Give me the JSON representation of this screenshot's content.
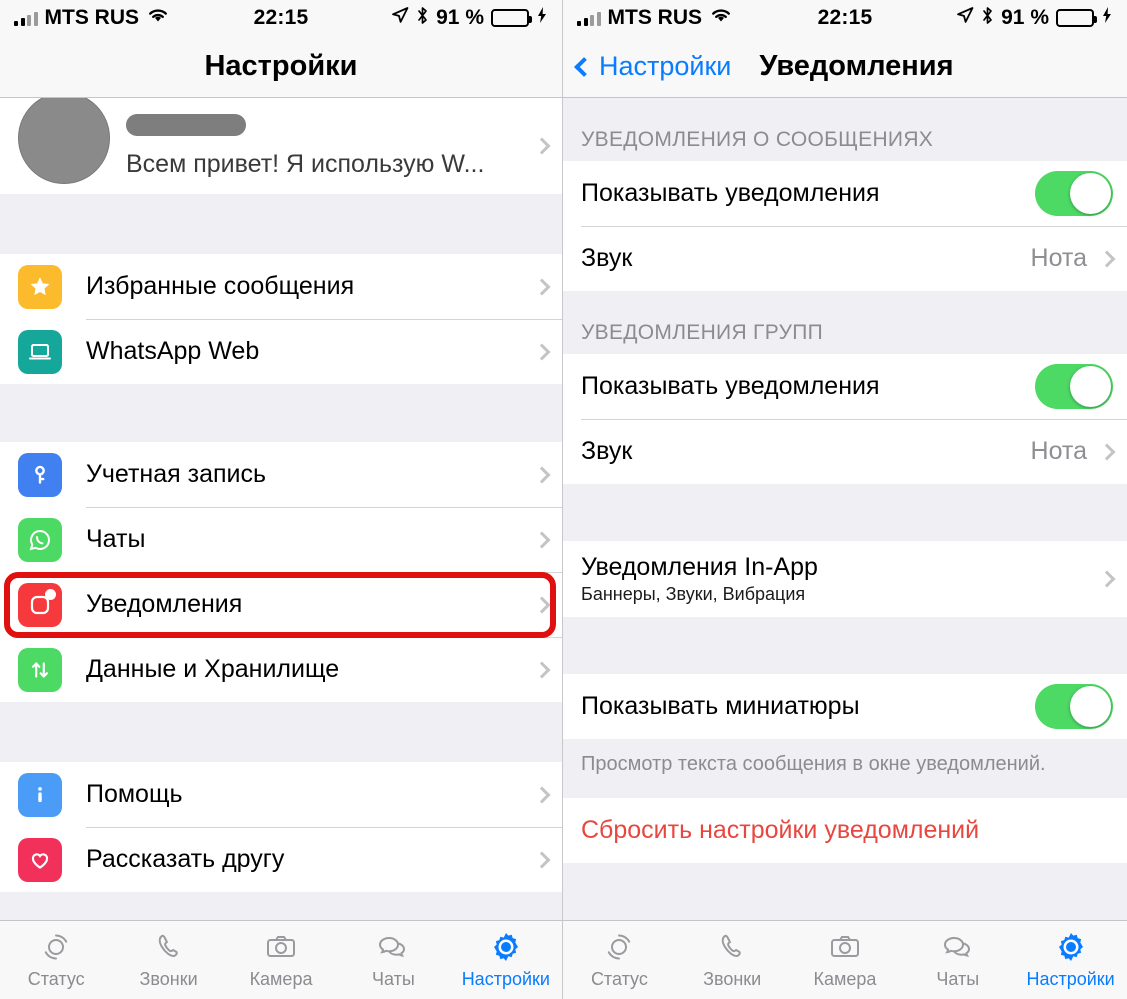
{
  "statusbar": {
    "carrier": "MTS RUS",
    "time": "22:15",
    "battery_percent": "91 %",
    "icons": [
      "signal-bars-icon",
      "wifi-icon",
      "location-arrow-icon",
      "bluetooth-icon",
      "battery-icon",
      "charging-bolt-icon"
    ]
  },
  "left_screen": {
    "nav": {
      "title": "Настройки"
    },
    "profile": {
      "name_redacted": true,
      "status": "Всем привет! Я использую W..."
    },
    "groups": [
      {
        "rows": [
          {
            "label": "Избранные сообщения",
            "icon": "star-icon",
            "icon_color": "#FCBB2C",
            "accessory": "chevron"
          },
          {
            "label": "WhatsApp Web",
            "icon": "laptop-icon",
            "icon_color": "#16A79B",
            "accessory": "chevron"
          }
        ]
      },
      {
        "rows": [
          {
            "label": "Учетная запись",
            "icon": "key-icon",
            "icon_color": "#4080F0",
            "accessory": "chevron"
          },
          {
            "label": "Чаты",
            "icon": "whatsapp-icon",
            "icon_color": "#4CD964",
            "accessory": "chevron"
          },
          {
            "label": "Уведомления",
            "icon": "notification-icon",
            "icon_color": "#F5393D",
            "accessory": "chevron",
            "highlighted": true
          },
          {
            "label": "Данные и Хранилище",
            "icon": "data-arrows-icon",
            "icon_color": "#4CD964",
            "accessory": "chevron"
          }
        ]
      },
      {
        "rows": [
          {
            "label": "Помощь",
            "icon": "info-icon",
            "icon_color": "#4A9CF6",
            "accessory": "chevron"
          },
          {
            "label": "Рассказать другу",
            "icon": "heart-icon",
            "icon_color": "#F2315A",
            "accessory": "chevron"
          }
        ]
      }
    ],
    "highlight_color": "#E01010"
  },
  "right_screen": {
    "nav": {
      "back_label": "Настройки",
      "title": "Уведомления"
    },
    "sections": [
      {
        "header": "УВЕДОМЛЕНИЯ О СООБЩЕНИЯХ",
        "rows": [
          {
            "label": "Показывать уведомления",
            "control": "toggle",
            "toggle_on": true
          },
          {
            "label": "Звук",
            "value": "Нота",
            "accessory": "chevron"
          }
        ]
      },
      {
        "header": "УВЕДОМЛЕНИЯ ГРУПП",
        "rows": [
          {
            "label": "Показывать уведомления",
            "control": "toggle",
            "toggle_on": true
          },
          {
            "label": "Звук",
            "value": "Нота",
            "accessory": "chevron"
          }
        ]
      },
      {
        "header": "",
        "rows": [
          {
            "label": "Уведомления In-App",
            "sublabel": "Баннеры, Звуки, Вибрация",
            "accessory": "chevron"
          }
        ]
      },
      {
        "header": "",
        "footer": "Просмотр текста сообщения в окне уведомлений.",
        "rows": [
          {
            "label": "Показывать миниатюры",
            "control": "toggle",
            "toggle_on": true
          }
        ]
      },
      {
        "header": "",
        "rows": [
          {
            "label": "Сбросить настройки уведомлений",
            "destructive": true
          }
        ]
      }
    ],
    "accent_toggle_color": "#4CD964",
    "destructive_color": "#E8473F"
  },
  "tabbar": {
    "items": [
      {
        "label": "Статус",
        "icon": "status-rings-icon",
        "active": false
      },
      {
        "label": "Звонки",
        "icon": "phone-icon",
        "active": false
      },
      {
        "label": "Камера",
        "icon": "camera-icon",
        "active": false
      },
      {
        "label": "Чаты",
        "icon": "chat-bubbles-icon",
        "active": false
      },
      {
        "label": "Настройки",
        "icon": "gear-icon",
        "active": true
      }
    ],
    "active_color": "#0a7cff",
    "inactive_color": "#8b8b90"
  }
}
